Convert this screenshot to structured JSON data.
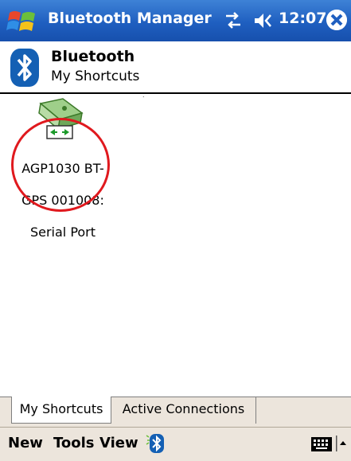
{
  "titlebar": {
    "app_title": "Bluetooth Manager",
    "clock": "12:07",
    "icons": [
      "windows-start-icon",
      "connectivity-icon",
      "volume-icon",
      "close-icon"
    ]
  },
  "header": {
    "title": "Bluetooth",
    "subtitle": "My Shortcuts"
  },
  "shortcuts": [
    {
      "label_lines": [
        "AGP1030 BT-",
        "GPS 001008:",
        "Serial Port"
      ],
      "icon": "serial-port-icon",
      "highlighted": true
    }
  ],
  "tabs": [
    {
      "label": "My Shortcuts",
      "active": true
    },
    {
      "label": "Active Connections",
      "active": false
    }
  ],
  "menubar": {
    "new": "New",
    "tools": "Tools",
    "view": "View"
  },
  "colors": {
    "titlebar": "#1f5fc0",
    "highlight_circle": "#e0191e",
    "menubar": "#ece5dc"
  }
}
